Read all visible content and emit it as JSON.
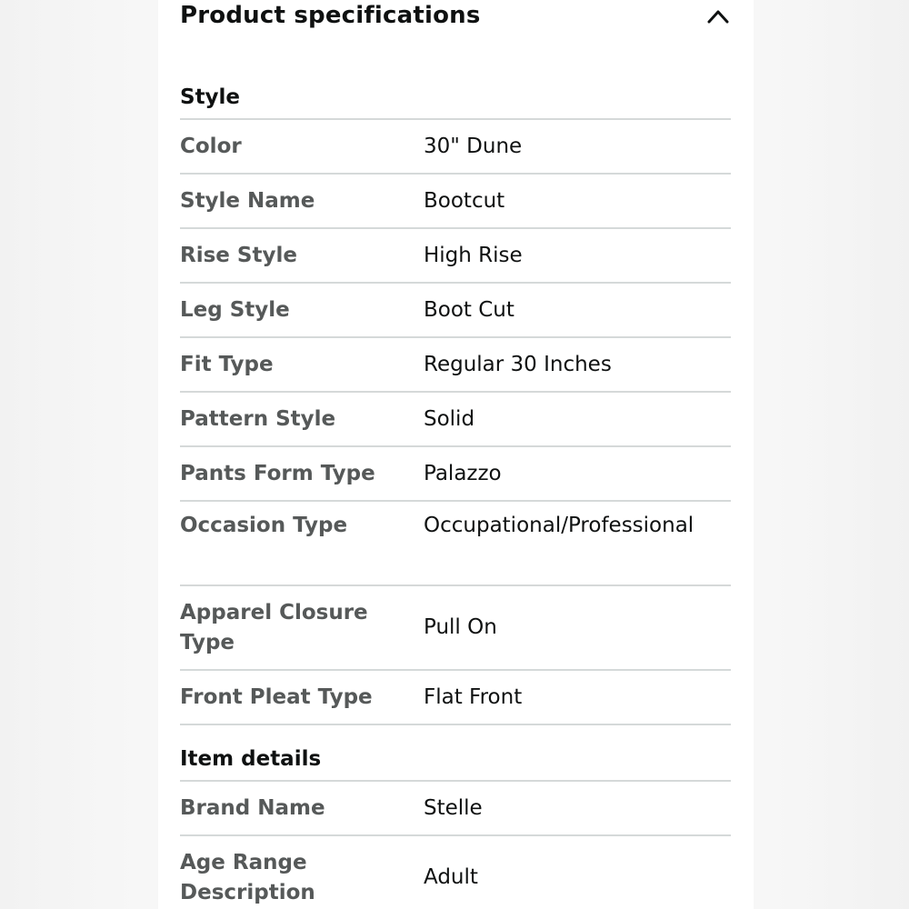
{
  "header": {
    "title": "Product specifications"
  },
  "sections": [
    {
      "title": "Style",
      "rows": [
        {
          "key": "Color",
          "value": "30\" Dune"
        },
        {
          "key": "Style Name",
          "value": "Bootcut"
        },
        {
          "key": "Rise Style",
          "value": "High Rise"
        },
        {
          "key": "Leg Style",
          "value": "Boot Cut"
        },
        {
          "key": "Fit Type",
          "value": "Regular 30 Inches"
        },
        {
          "key": "Pattern Style",
          "value": "Solid"
        },
        {
          "key": "Pants Form Type",
          "value": "Palazzo"
        },
        {
          "key": "Occasion Type",
          "value": "Occupational/Professional"
        },
        {
          "key": "Apparel Closure Type",
          "value": "Pull On"
        },
        {
          "key": "Front Pleat Type",
          "value": "Flat Front"
        }
      ]
    },
    {
      "title": "Item details",
      "rows": [
        {
          "key": "Brand Name",
          "value": "Stelle"
        },
        {
          "key": "Age Range Description",
          "value": "Adult"
        }
      ]
    }
  ],
  "icons": {
    "collapse": "chevron-up-icon"
  },
  "colors": {
    "key_text": "#565959",
    "value_text": "#0f1111",
    "divider": "#d5d9d9"
  }
}
